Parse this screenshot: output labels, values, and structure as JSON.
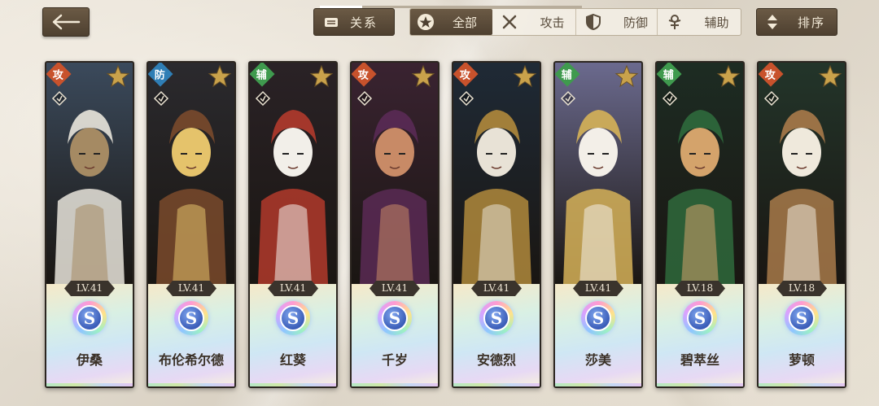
{
  "header": {
    "back_icon": "arrow-left-icon",
    "relations_label": "关系",
    "filters": {
      "all_label": "全部",
      "attack_label": "攻击",
      "defense_label": "防御",
      "support_label": "辅助"
    },
    "sort_label": "排序"
  },
  "characters": [
    {
      "name": "伊桑",
      "role": "攻",
      "role_type": "attack",
      "level": "LV.41",
      "rank": "S",
      "palette": [
        "#3b4a5c",
        "#a58a63",
        "#e9e5dc"
      ]
    },
    {
      "name": "布伦希尔德",
      "role": "防",
      "role_type": "defense",
      "level": "LV.41",
      "rank": "S",
      "palette": [
        "#2b2a2e",
        "#e5c36b",
        "#7a4a2c"
      ]
    },
    {
      "name": "红葵",
      "role": "辅",
      "role_type": "support",
      "level": "LV.41",
      "rank": "S",
      "palette": [
        "#2a2226",
        "#f2efe9",
        "#b23a2c"
      ]
    },
    {
      "name": "千岁",
      "role": "攻",
      "role_type": "attack",
      "level": "LV.41",
      "rank": "S",
      "palette": [
        "#3a2331",
        "#c88a66",
        "#5a2a55"
      ]
    },
    {
      "name": "安德烈",
      "role": "攻",
      "role_type": "attack",
      "level": "LV.41",
      "rank": "S",
      "palette": [
        "#1f2a36",
        "#e8e2d6",
        "#b08a3c"
      ]
    },
    {
      "name": "莎美",
      "role": "辅",
      "role_type": "support",
      "level": "LV.41",
      "rank": "S",
      "palette": [
        "#6b6a8e",
        "#f3efe8",
        "#d6b258"
      ]
    },
    {
      "name": "碧萃丝",
      "role": "辅",
      "role_type": "support",
      "level": "LV.18",
      "rank": "S",
      "palette": [
        "#1d2c23",
        "#d4a36b",
        "#2f6a3c"
      ]
    },
    {
      "name": "萝顿",
      "role": "攻",
      "role_type": "attack",
      "level": "LV.18",
      "rank": "S",
      "palette": [
        "#23352a",
        "#efe9dc",
        "#a87a4a"
      ]
    }
  ],
  "colors": {
    "button_brown": "#5c4b39",
    "attack_role": "#c8522c",
    "defense_role": "#2f7eb5",
    "support_role": "#3f9a4e"
  },
  "tab_progress": 0.16
}
